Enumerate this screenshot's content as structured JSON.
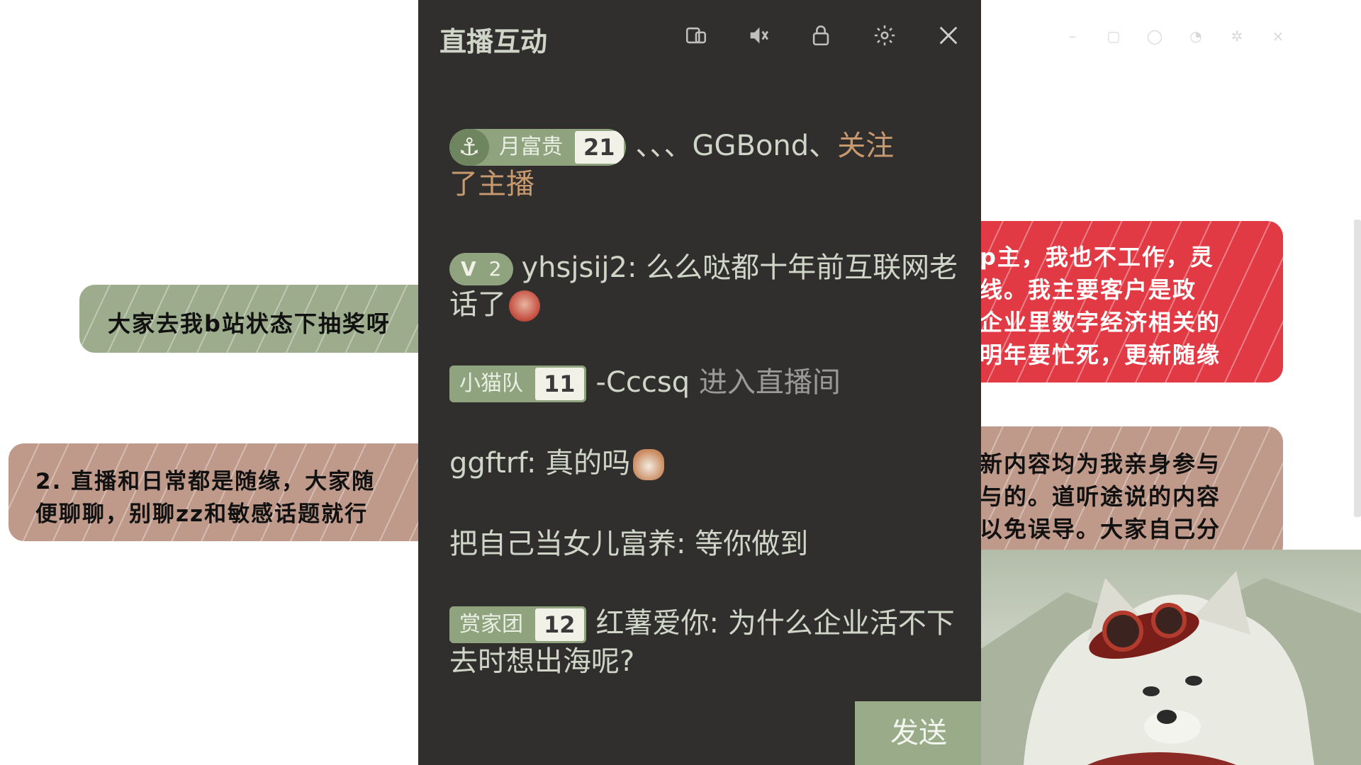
{
  "notes": {
    "green": "大家去我b站状态下抽奖呀",
    "tan_lines": [
      "2. 直播和日常都是随缘，大家随",
      "便聊聊，别聊zz和敏感话题就行"
    ],
    "red_lines": [
      "p主，我也不工作，灵",
      "线。我主要客户是政",
      "企业里数字经济相关的",
      "明年要忙死，更新随缘"
    ],
    "tan2_lines": [
      "新内容均为我亲身参与",
      "与的。道听途说的内容",
      "以免误导。大家自己分"
    ]
  },
  "panel": {
    "title": "直播互动",
    "icons": [
      "pip-icon",
      "mic-icon",
      "lock-icon",
      "gear-icon",
      "close-icon"
    ],
    "send_label": "发送"
  },
  "messages": [
    {
      "badge_name": "月富贵",
      "badge_level": "21",
      "user": "、、、GGBond、",
      "text_a": "关注",
      "text_b": "了主播"
    },
    {
      "vip_level": "2",
      "user": "yhsjsij2:",
      "text": "么么哒都十年前互联网老话了"
    },
    {
      "badge_name": "小猫队",
      "badge_level": "11",
      "user": "-Cccsq",
      "text": "进入直播间"
    },
    {
      "user": "ggftrf:",
      "text": "真的吗"
    },
    {
      "user": "把自己当女儿富养:",
      "text": "等你做到"
    },
    {
      "badge_name": "赏家团",
      "badge_level": "12",
      "user": "红薯爱你:",
      "text": "为什么企业活不下去时想出海呢?"
    }
  ],
  "colors": {
    "panel_bg": "#312e2e",
    "badge_green": "#8ea37e",
    "system_orange": "#c7996e",
    "note_red": "#e23a44"
  }
}
